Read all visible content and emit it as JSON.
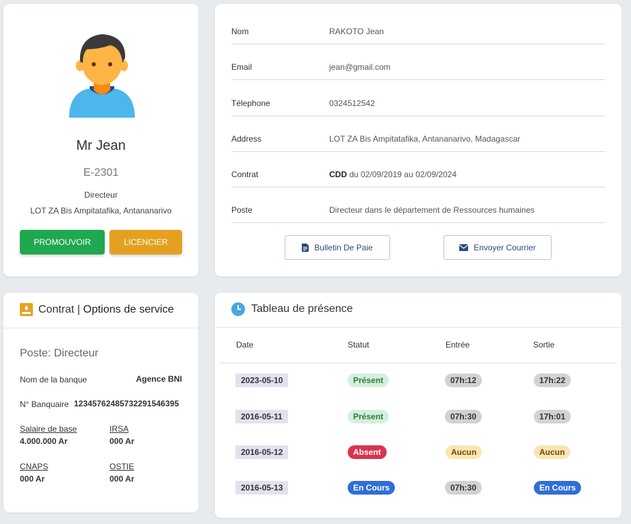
{
  "profile": {
    "name": "Mr Jean",
    "code": "E-2301",
    "role": "Directeur",
    "address": "LOT ZA Bis Ampitatafika, Antananarivo",
    "promote_label": "PROMOUVOIR",
    "fire_label": "LICENCIER",
    "avatar_icon": "user-avatar-icon"
  },
  "details": {
    "rows": [
      {
        "label": "Nom",
        "value": "RAKOTO Jean"
      },
      {
        "label": "Email",
        "value": "jean@gmail.com"
      },
      {
        "label": "Télephone",
        "value": "0324512542"
      },
      {
        "label": "Address",
        "value": "LOT ZA Bis Ampitatafika, Antananarivo, Madagascar"
      },
      {
        "label": "Contrat",
        "value_type": "CDD",
        "value_rest": " du 02/09/2019 au 02/09/2024"
      },
      {
        "label": "Poste",
        "value": "Directeur dans le département de Ressources humaines"
      }
    ],
    "payslip_label": "Bulletin De Paie",
    "mail_label": "Envoyer Courrier"
  },
  "contract": {
    "title_a": "Contrat | ",
    "title_b": "Options de service",
    "poste": "Poste: Directeur",
    "bank_label": "Nom de la banque",
    "bank_value": "Agence BNI",
    "account_label": "N° Banquaire",
    "account_value": "12345762485732291546395",
    "salary_label": "Salaire de base",
    "salary_value": "4.000.000 Ar",
    "irsa_label": "IRSA",
    "irsa_value": "000 Ar",
    "cnaps_label": "CNAPS",
    "cnaps_value": "000 Ar",
    "ostie_label": "OSTIE",
    "ostie_value": "000 Ar"
  },
  "presence": {
    "title": "Tableau de présence",
    "columns": [
      "Date",
      "Statut",
      "Entrée",
      "Sortie"
    ],
    "rows": [
      {
        "date": "2023-05-10",
        "status": "Présent",
        "in": "07h:12",
        "out": "17h:22"
      },
      {
        "date": "2016-05-11",
        "status": "Présent",
        "in": "07h:30",
        "out": "17h:01"
      },
      {
        "date": "2016-05-12",
        "status": "Absent",
        "in": "Aucun",
        "out": "Aucun"
      },
      {
        "date": "2016-05-13",
        "status": "En Cours",
        "in": "07h:30",
        "out": "En Cours"
      }
    ]
  },
  "colors": {
    "promote": "#1fa84f",
    "fire": "#e3a11f",
    "present": "#d4f0dc",
    "absent": "#d9344f",
    "in_progress": "#2f6fd6",
    "none": "#fbe5b4",
    "time": "#d2d2d2"
  }
}
